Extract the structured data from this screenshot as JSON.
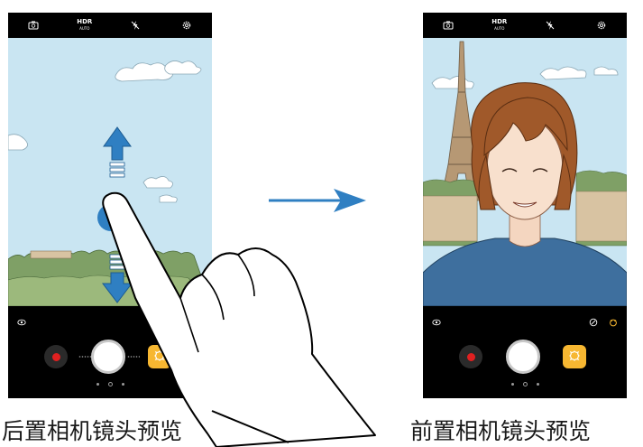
{
  "left_phone": {
    "top_icons": [
      "switch-camera-icon",
      "hdr-auto-icon",
      "flash-off-icon",
      "settings-icon"
    ],
    "hdr_label": "HDR",
    "hdr_sub": "AUTO",
    "bottom_icons": [
      "view-mode-icon"
    ],
    "caption": "后置相机镜头预览"
  },
  "right_phone": {
    "top_icons": [
      "switch-camera-icon",
      "hdr-auto-icon",
      "flash-off-icon",
      "settings-icon"
    ],
    "hdr_label": "HDR",
    "hdr_sub": "AUTO",
    "bottom_icons": [
      "view-mode-icon",
      "beauty-icon",
      "sticker-icon"
    ],
    "caption": "前置相机镜头预览"
  },
  "colors": {
    "arrow": "#2f7fc2",
    "record": "#e02020",
    "effects": "#f7b731",
    "sky": "#c9e5f2"
  }
}
